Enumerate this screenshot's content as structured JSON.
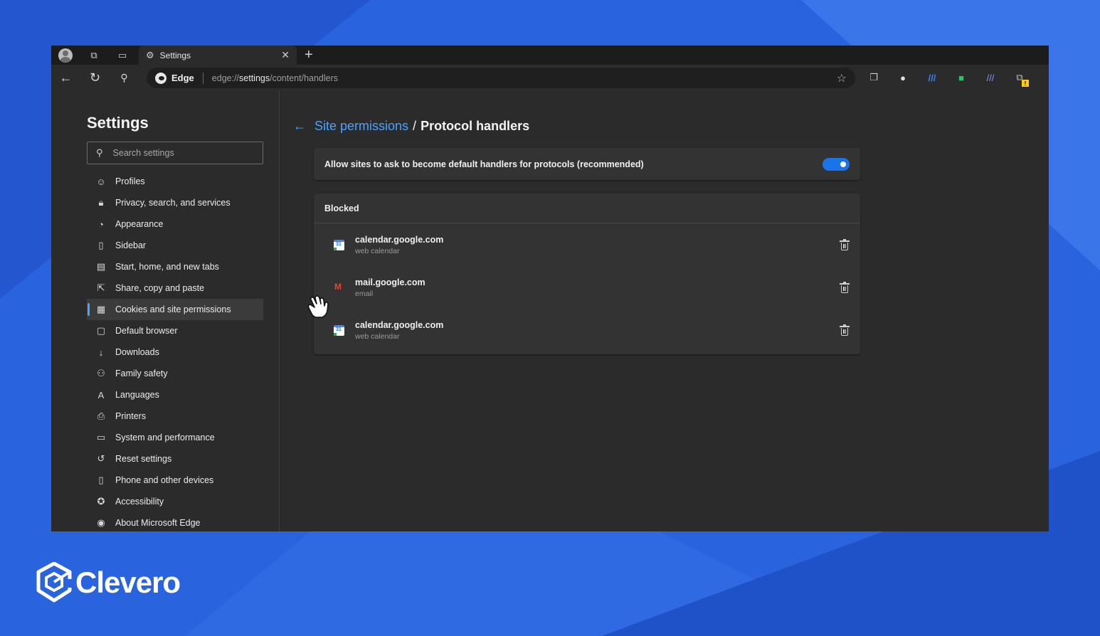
{
  "colors": {
    "accent": "#4aa3ff",
    "toggle_on": "#1a73e8",
    "page_bg": "#2a63de",
    "panel_bg": "#2b2b2b",
    "card_bg": "#333333"
  },
  "browser": {
    "tab": {
      "title": "Settings",
      "icon": "gear-icon",
      "close": "✕"
    },
    "new_tab": "+",
    "omnibox": {
      "brand": "Edge",
      "url_prefix": "edge://",
      "url_highlight": "settings",
      "url_suffix": "/content/handlers"
    }
  },
  "sidebar": {
    "title": "Settings",
    "search_placeholder": "Search settings",
    "items": [
      {
        "label": "Profiles",
        "icon": "profile-icon"
      },
      {
        "label": "Privacy, search, and services",
        "icon": "lock-icon"
      },
      {
        "label": "Appearance",
        "icon": "palette-icon"
      },
      {
        "label": "Sidebar",
        "icon": "sidebar-icon"
      },
      {
        "label": "Start, home, and new tabs",
        "icon": "home-icon"
      },
      {
        "label": "Share, copy and paste",
        "icon": "share-icon"
      },
      {
        "label": "Cookies and site permissions",
        "icon": "cookie-icon",
        "active": true
      },
      {
        "label": "Default browser",
        "icon": "browser-icon"
      },
      {
        "label": "Downloads",
        "icon": "download-icon"
      },
      {
        "label": "Family safety",
        "icon": "family-icon"
      },
      {
        "label": "Languages",
        "icon": "language-icon"
      },
      {
        "label": "Printers",
        "icon": "printer-icon"
      },
      {
        "label": "System and performance",
        "icon": "laptop-icon"
      },
      {
        "label": "Reset settings",
        "icon": "reset-icon"
      },
      {
        "label": "Phone and other devices",
        "icon": "phone-icon"
      },
      {
        "label": "Accessibility",
        "icon": "accessibility-icon"
      },
      {
        "label": "About Microsoft Edge",
        "icon": "edge-icon"
      }
    ]
  },
  "main": {
    "breadcrumb": {
      "parent": "Site permissions",
      "separator": "/",
      "current": "Protocol handlers"
    },
    "toggle_setting": {
      "label": "Allow sites to ask to become default handlers for protocols (recommended)",
      "enabled": true
    },
    "blocked": {
      "header": "Blocked",
      "sites": [
        {
          "name": "calendar.google.com",
          "desc": "web calendar",
          "icon": "google-calendar-icon"
        },
        {
          "name": "mail.google.com",
          "desc": "email",
          "icon": "gmail-icon"
        },
        {
          "name": "calendar.google.com",
          "desc": "web calendar",
          "icon": "google-calendar-icon"
        }
      ]
    }
  },
  "brand": {
    "name": "Clevero"
  }
}
